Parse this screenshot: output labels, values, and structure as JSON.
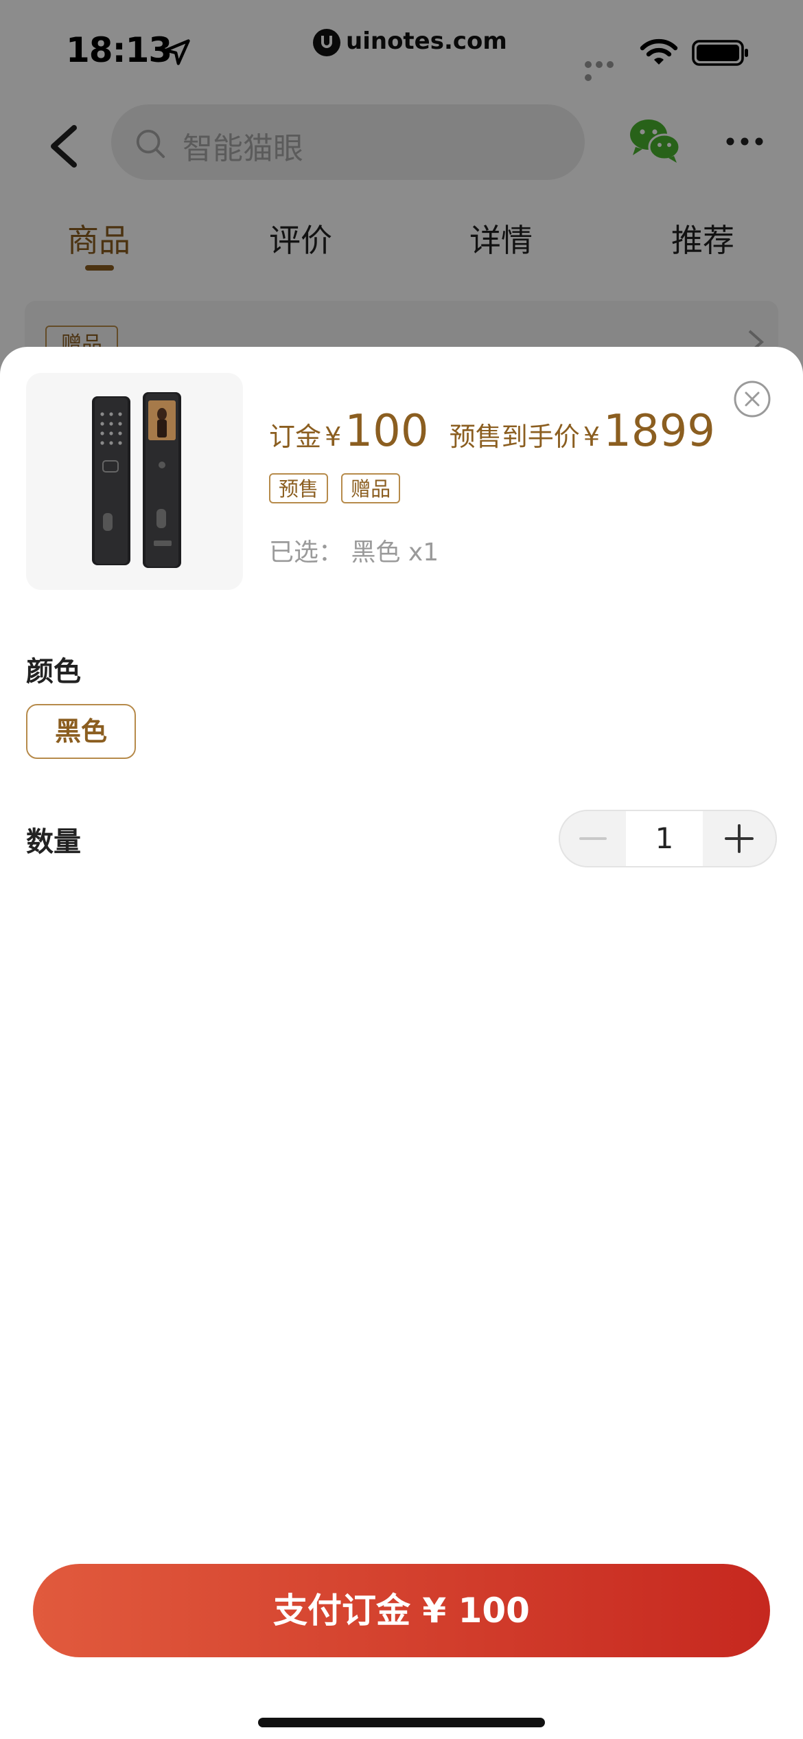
{
  "status_bar": {
    "time": "18:13",
    "watermark": "uinotes.com"
  },
  "nav": {
    "search_placeholder": "智能猫眼"
  },
  "tabs": [
    {
      "label": "商品",
      "active": true
    },
    {
      "label": "评价"
    },
    {
      "label": "详情"
    },
    {
      "label": "推荐"
    }
  ],
  "background": {
    "gift_tag": "赠品"
  },
  "sheet": {
    "deposit_label": "订金",
    "currency": "¥",
    "deposit_price": "100",
    "presale_label": "预售到手价",
    "presale_price": "1899",
    "tags": [
      "预售",
      "赠品"
    ],
    "selected": "已选： 黑色 x1",
    "color_title": "颜色",
    "color_option": "黑色",
    "quantity_title": "数量",
    "quantity": "1",
    "pay_button": "支付订金 ¥ 100"
  },
  "colors": {
    "accent": "#8b5e20",
    "pay_gradient_start": "#e15a3d",
    "pay_gradient_end": "#c6281f"
  }
}
